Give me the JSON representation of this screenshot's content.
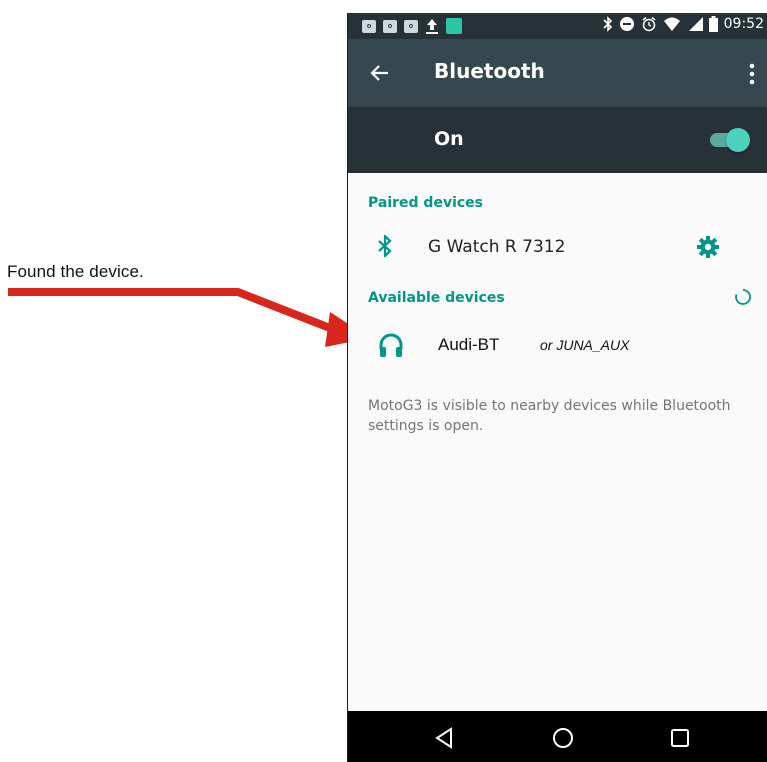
{
  "annotation": {
    "text": "Found the device."
  },
  "status_bar": {
    "time": "09:52",
    "icons": [
      "outlook-notification-icon",
      "outlook-notification-icon",
      "outlook-notification-icon",
      "upload-icon",
      "app-notification-icon",
      "bluetooth-icon",
      "do-not-disturb-icon",
      "alarm-icon",
      "wifi-icon",
      "signal-icon",
      "battery-icon"
    ]
  },
  "toolbar": {
    "title": "Bluetooth"
  },
  "switch": {
    "label": "On",
    "state": "on"
  },
  "paired": {
    "header": "Paired devices",
    "devices": [
      {
        "name": "G Watch R 7312",
        "icon": "bluetooth-icon"
      }
    ]
  },
  "available": {
    "header": "Available devices",
    "devices": [
      {
        "name": "Audi-BT",
        "alt_name": "or JUNA_AUX",
        "icon": "headset-icon"
      }
    ]
  },
  "info": {
    "text": "MotoG3 is visible to nearby devices while Bluetooth settings is open."
  },
  "colors": {
    "accent": "#009688",
    "toolbar": "#37474f",
    "status_bar": "#263238",
    "arrow": "#d9261c"
  }
}
